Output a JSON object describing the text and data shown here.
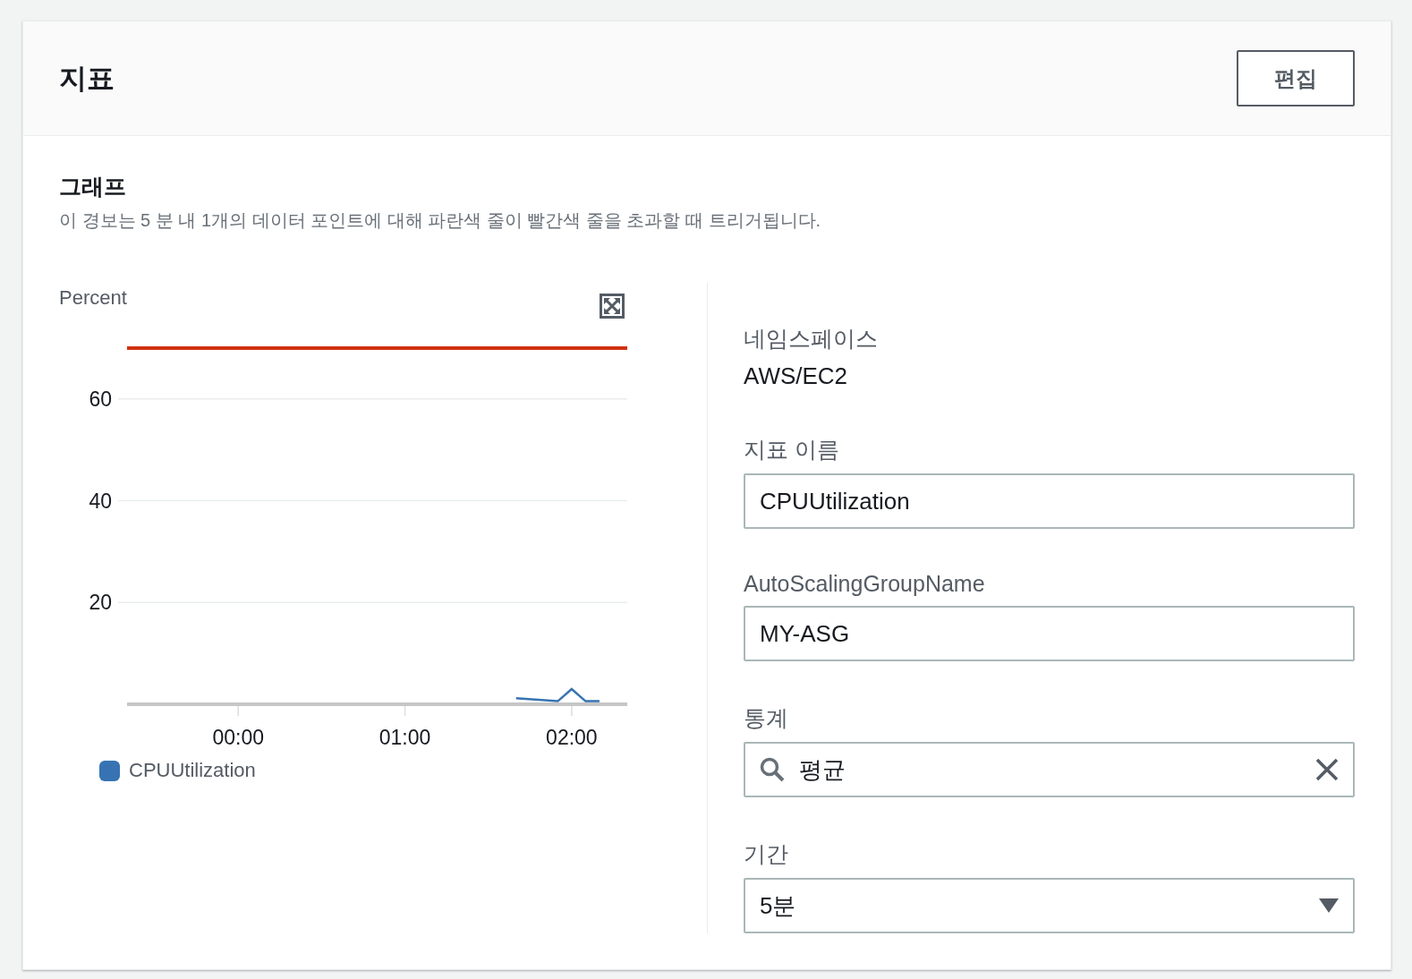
{
  "header": {
    "title": "지표",
    "edit_button": "편집"
  },
  "graph": {
    "title": "그래프",
    "description": "이 경보는 5 분 내 1개의 데이터 포인트에 대해 파란색 줄이 빨간색 줄을 초과할 때 트리거됩니다.",
    "chart_data": {
      "type": "line",
      "ylabel": "Percent",
      "x": [
        100,
        115,
        120,
        125,
        130
      ],
      "series": [
        {
          "name": "CPUUtilization",
          "color": "#3773b3",
          "values": [
            1.2,
            0.6,
            3.0,
            0.6,
            0.6
          ]
        }
      ],
      "xlim": [
        -40,
        140
      ],
      "ylim": [
        0,
        70
      ],
      "grid": true,
      "xticks": [
        {
          "value": 0,
          "label": "00:00"
        },
        {
          "value": 60,
          "label": "01:00"
        },
        {
          "value": 120,
          "label": "02:00"
        }
      ],
      "yticks": [
        20,
        40,
        60
      ],
      "ref_lines": [
        {
          "axis": "y",
          "value": 70,
          "color": "#d13212"
        }
      ]
    }
  },
  "details": {
    "namespace": {
      "label": "네임스페이스",
      "value": "AWS/EC2"
    },
    "fields": [
      {
        "kind": "text",
        "label": "지표 이름",
        "value": "CPUUtilization"
      },
      {
        "kind": "text",
        "label": "AutoScalingGroupName",
        "value": "MY-ASG"
      },
      {
        "kind": "search",
        "label": "통계",
        "value": "평균"
      },
      {
        "kind": "select",
        "label": "기간",
        "value": "5분"
      }
    ]
  }
}
